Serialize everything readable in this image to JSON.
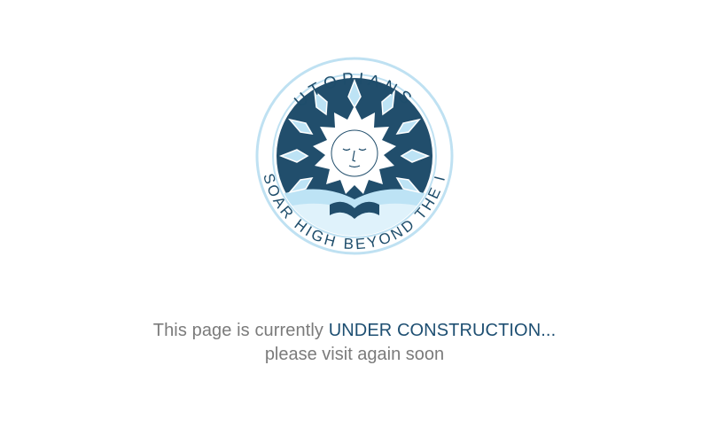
{
  "logo": {
    "name": "utopians-logo",
    "top_text": "UTOPIANS",
    "bottom_text": "SOAR HIGH BEYOND THE I",
    "colors": {
      "navy": "#1e4d6b",
      "light_blue": "#a9d7f0",
      "ring": "#c7e4f3"
    }
  },
  "message": {
    "prefix": "This page is currently ",
    "emphasis": "UNDER CONSTRUCTION...",
    "line2": "please visit again soon",
    "colors": {
      "text": "#7b7b7b",
      "emphasis": "#1e4f72"
    }
  }
}
